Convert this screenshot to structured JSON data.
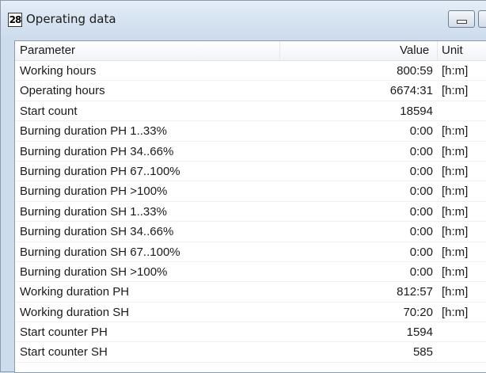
{
  "window": {
    "title": "Operating data",
    "icon_label": "28"
  },
  "table": {
    "headers": {
      "parameter": "Parameter",
      "value": "Value",
      "unit": "Unit"
    },
    "rows": [
      {
        "parameter": "Working hours",
        "value": "800:59",
        "unit": "[h:m]"
      },
      {
        "parameter": "Operating hours",
        "value": "6674:31",
        "unit": "[h:m]"
      },
      {
        "parameter": "Start count",
        "value": "18594",
        "unit": ""
      },
      {
        "parameter": "Burning duration PH 1..33%",
        "value": "0:00",
        "unit": "[h:m]"
      },
      {
        "parameter": "Burning duration PH 34..66%",
        "value": "0:00",
        "unit": "[h:m]"
      },
      {
        "parameter": "Burning duration PH 67..100%",
        "value": "0:00",
        "unit": "[h:m]"
      },
      {
        "parameter": "Burning duration PH >100%",
        "value": "0:00",
        "unit": "[h:m]"
      },
      {
        "parameter": "Burning duration SH 1..33%",
        "value": "0:00",
        "unit": "[h:m]"
      },
      {
        "parameter": "Burning duration SH 34..66%",
        "value": "0:00",
        "unit": "[h:m]"
      },
      {
        "parameter": "Burning duration SH 67..100%",
        "value": "0:00",
        "unit": "[h:m]"
      },
      {
        "parameter": "Burning duration SH >100%",
        "value": "0:00",
        "unit": "[h:m]"
      },
      {
        "parameter": "Working duration PH",
        "value": "812:57",
        "unit": "[h:m]"
      },
      {
        "parameter": "Working duration SH",
        "value": "70:20",
        "unit": "[h:m]"
      },
      {
        "parameter": "Start counter PH",
        "value": "1594",
        "unit": ""
      },
      {
        "parameter": "Start counter SH",
        "value": "585",
        "unit": ""
      }
    ]
  },
  "colors": {
    "title_bg": "#d6e3f1",
    "panel_bg": "#ffffff",
    "border": "#8f9bab"
  }
}
